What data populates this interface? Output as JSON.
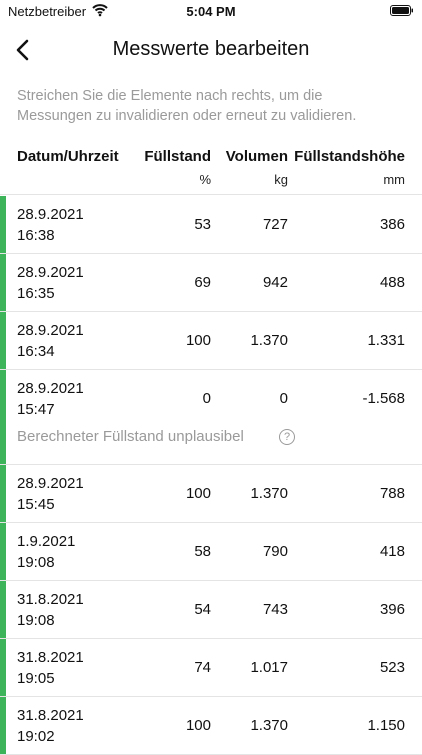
{
  "status": {
    "carrier": "Netzbetreiber",
    "time": "5:04 PM"
  },
  "nav": {
    "title": "Messwerte bearbeiten"
  },
  "hint": "Streichen Sie die Elemente nach rechts, um die Messungen zu invalidieren oder erneut zu validieren.",
  "columns": [
    {
      "label": "Datum/Uhrzeit",
      "unit": ""
    },
    {
      "label": "Füllstand",
      "unit": "%"
    },
    {
      "label": "Volumen",
      "unit": "kg"
    },
    {
      "label": "Füllstandshöhe",
      "unit": "mm"
    }
  ],
  "rows": [
    {
      "date": "28.9.2021",
      "time": "16:38",
      "fill": "53",
      "volume": "727",
      "height": "386",
      "warning": ""
    },
    {
      "date": "28.9.2021",
      "time": "16:35",
      "fill": "69",
      "volume": "942",
      "height": "488",
      "warning": ""
    },
    {
      "date": "28.9.2021",
      "time": "16:34",
      "fill": "100",
      "volume": "1.370",
      "height": "1.331",
      "warning": ""
    },
    {
      "date": "28.9.2021",
      "time": "15:47",
      "fill": "0",
      "volume": "0",
      "height": "-1.568",
      "warning": "Berechneter Füllstand unplausibel"
    },
    {
      "date": "28.9.2021",
      "time": "15:45",
      "fill": "100",
      "volume": "1.370",
      "height": "788",
      "warning": ""
    },
    {
      "date": "1.9.2021",
      "time": "19:08",
      "fill": "58",
      "volume": "790",
      "height": "418",
      "warning": ""
    },
    {
      "date": "31.8.2021",
      "time": "19:08",
      "fill": "54",
      "volume": "743",
      "height": "396",
      "warning": ""
    },
    {
      "date": "31.8.2021",
      "time": "19:05",
      "fill": "74",
      "volume": "1.017",
      "height": "523",
      "warning": ""
    },
    {
      "date": "31.8.2021",
      "time": "19:02",
      "fill": "100",
      "volume": "1.370",
      "height": "1.150",
      "warning": ""
    }
  ],
  "colors": {
    "valid_bar": "#3db35a",
    "muted_text": "#9a9a9a"
  },
  "icons": {
    "back": "chevron-left-icon",
    "help": "question-circle-icon"
  }
}
